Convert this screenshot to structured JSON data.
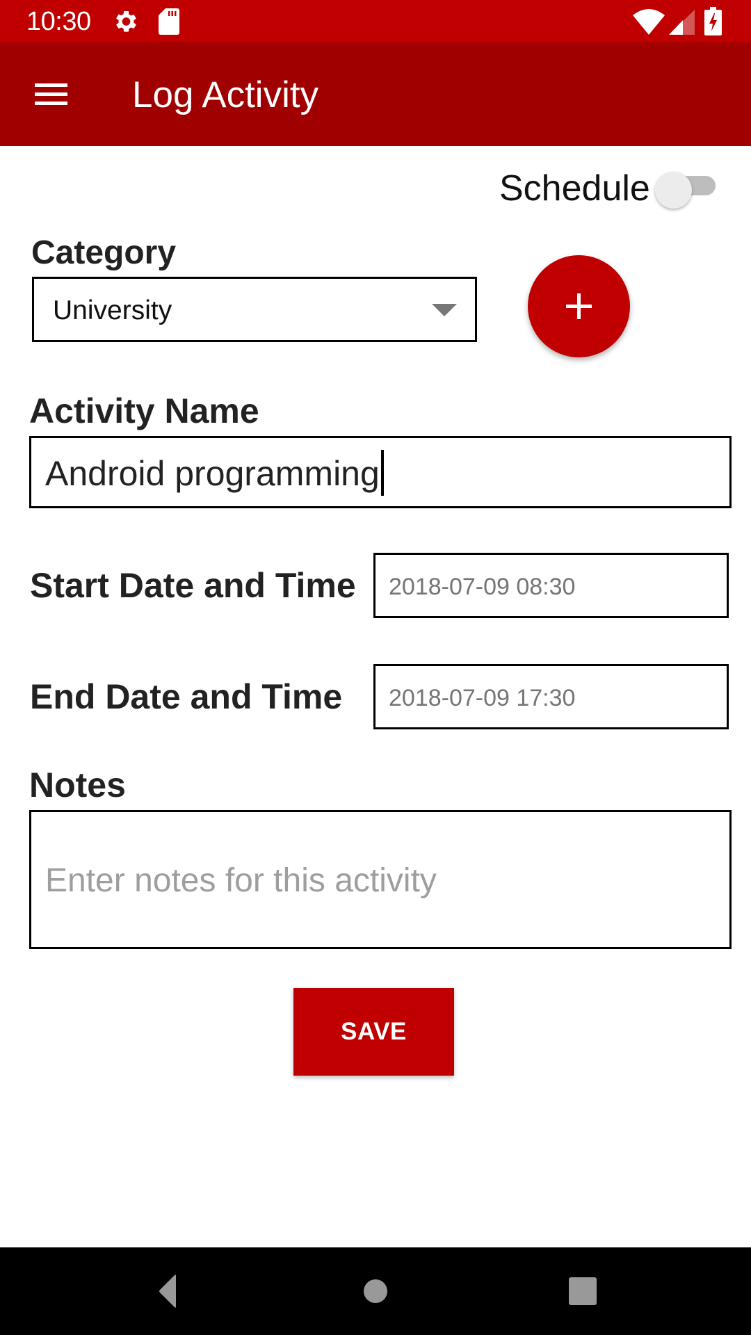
{
  "status_bar": {
    "time": "10:30",
    "icons": [
      "gear-icon",
      "sd-card-icon",
      "wifi-icon",
      "cell-signal-icon",
      "battery-charging-icon"
    ]
  },
  "app_bar": {
    "menu_icon": "hamburger-menu-icon",
    "title": "Log Activity"
  },
  "form": {
    "schedule": {
      "label": "Schedule",
      "enabled": false
    },
    "category": {
      "label": "Category",
      "selected": "University",
      "add_button_icon": "plus-icon"
    },
    "activity_name": {
      "label": "Activity Name",
      "value": "Android programming"
    },
    "start": {
      "label": "Start Date and Time",
      "value": "2018-07-09 08:30"
    },
    "end": {
      "label": "End Date and Time",
      "value": "2018-07-09 17:30"
    },
    "notes": {
      "label": "Notes",
      "placeholder": "Enter notes for this activity",
      "value": ""
    },
    "save_label": "SAVE"
  },
  "nav_bar": {
    "buttons": [
      "back",
      "home",
      "recents"
    ]
  },
  "colors": {
    "status_bar": "#C00000",
    "app_bar": "#A00000",
    "accent": "#C00000"
  }
}
